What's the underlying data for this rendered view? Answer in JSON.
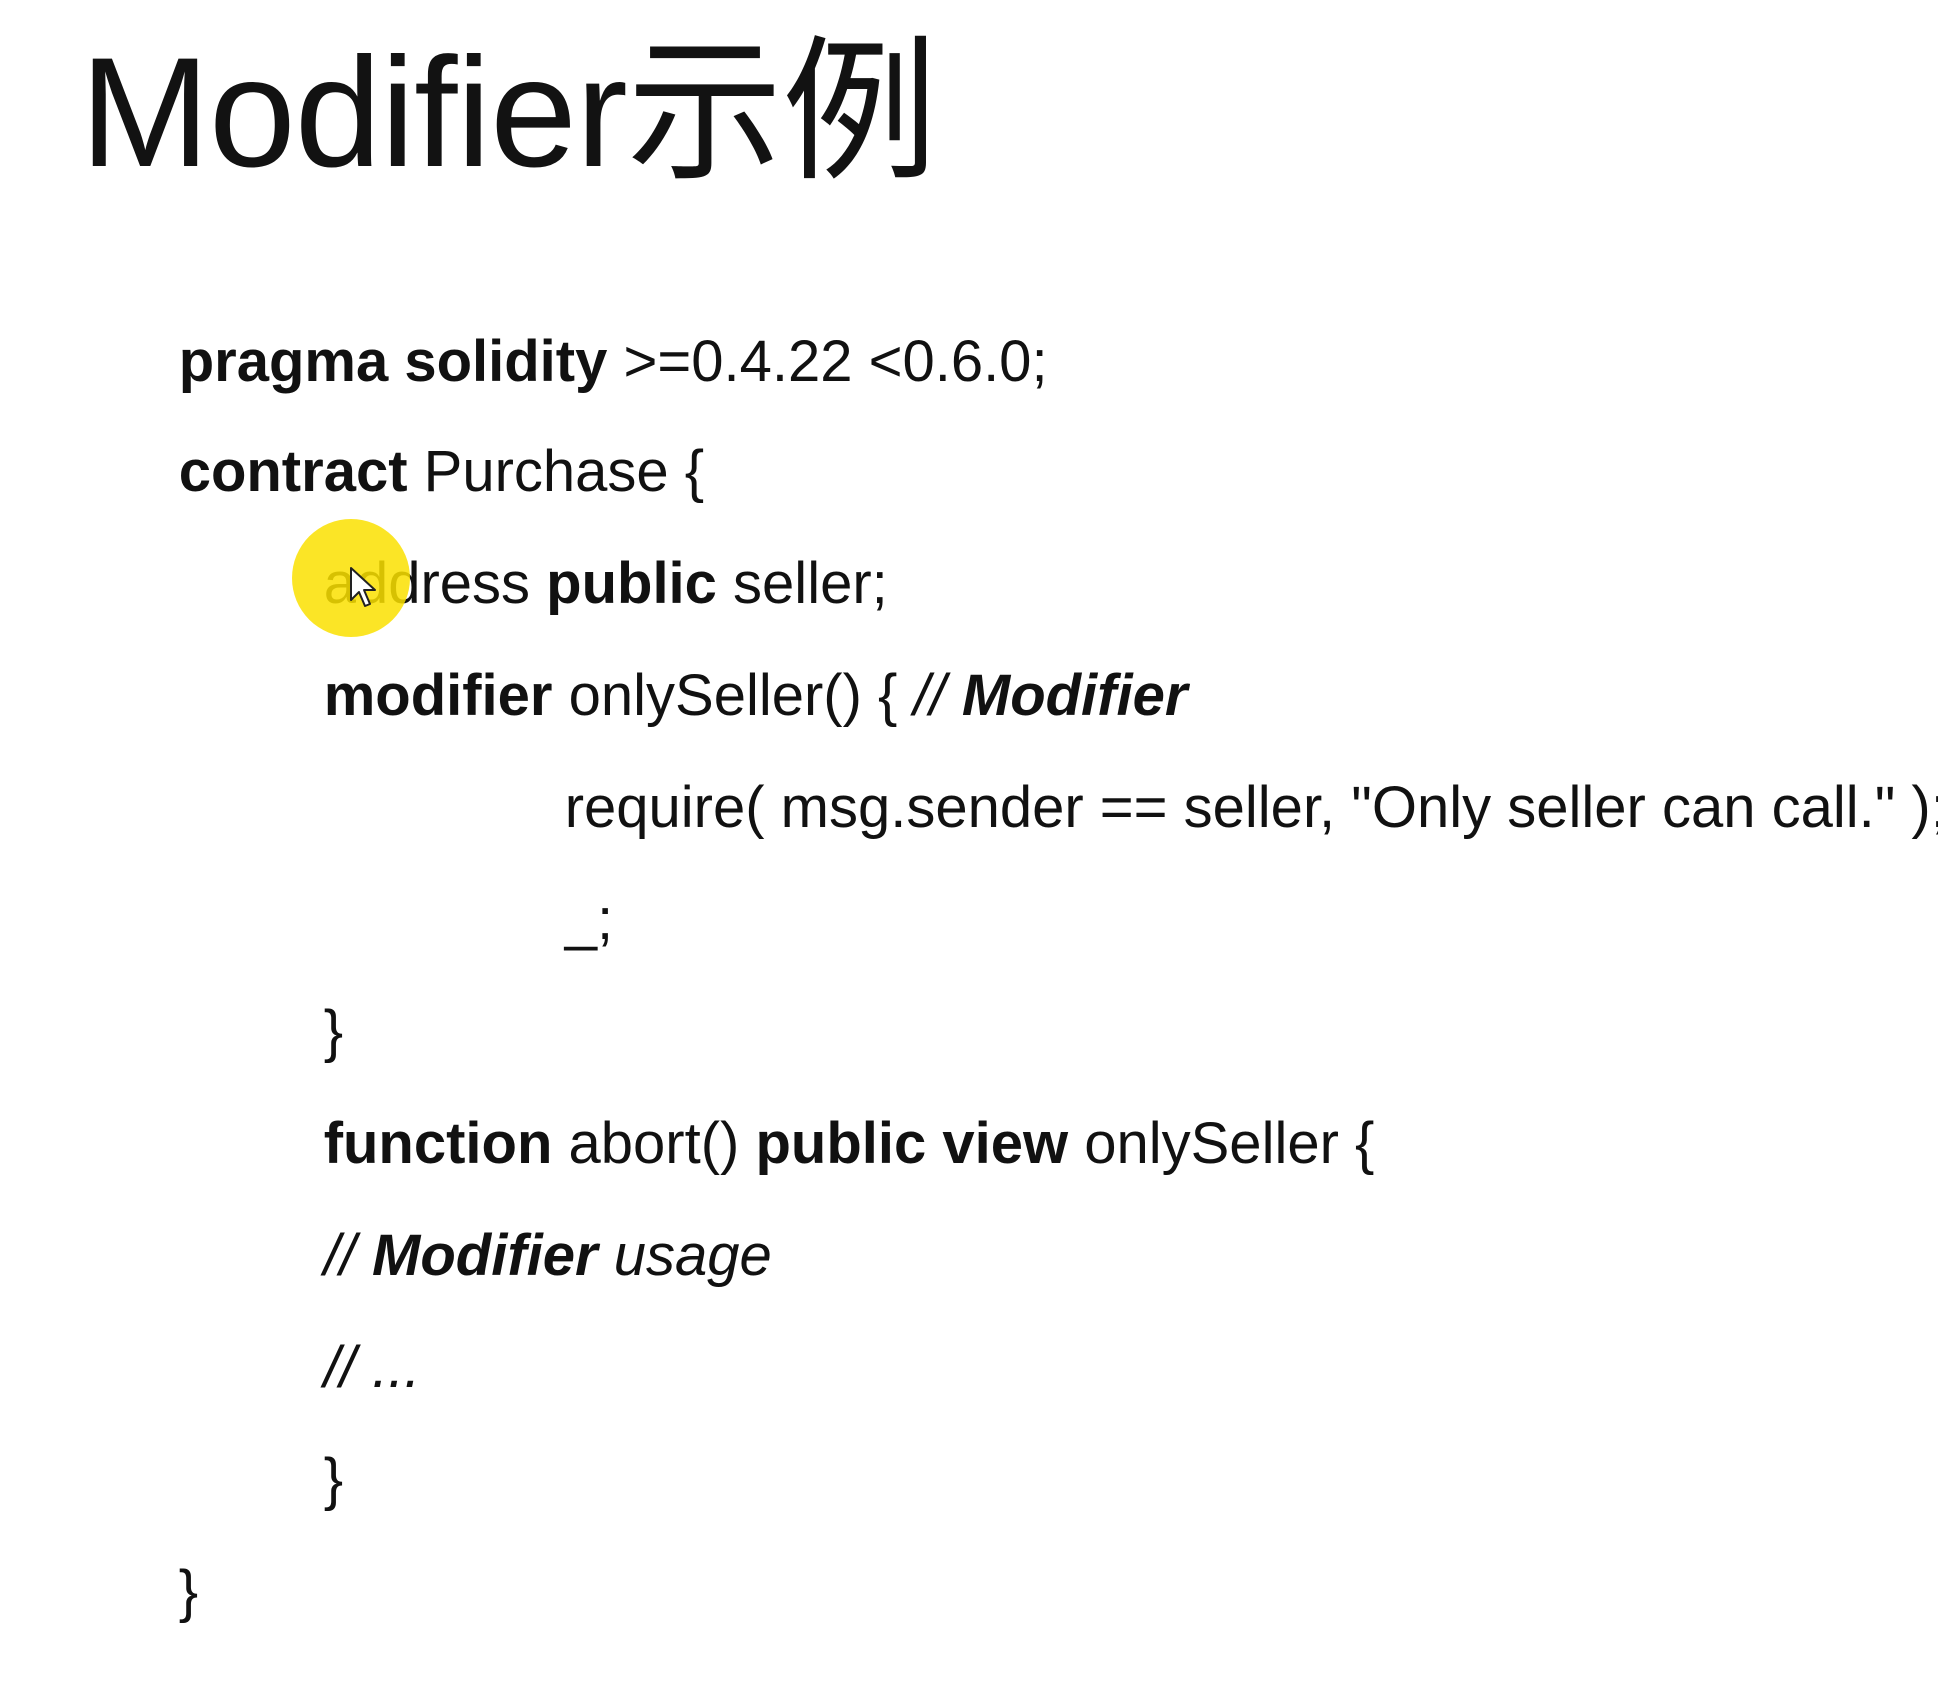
{
  "slide": {
    "title": "Modifier示例",
    "code_lines": {
      "l1": {
        "a": "pragma solidity",
        "b": " >=0.4.22 <0.6.0;"
      },
      "l2": {
        "a": "contract",
        "b": " Purchase {"
      },
      "l3": {
        "a": "address ",
        "b": "public",
        "c": " seller;"
      },
      "l4": {
        "a": "modifier",
        "b": " onlySeller() { ",
        "c": "// ",
        "d": "Modifier"
      },
      "l5": {
        "a": "require( msg.sender == seller, \"Only seller can call.\" );"
      },
      "l6": {
        "a": "_;"
      },
      "l7": {
        "a": "}"
      },
      "l8": {
        "a": "function",
        "b": " abort() ",
        "c": "public view",
        "d": " onlySeller {"
      },
      "l9": {
        "a": "// ",
        "b": "Modifier",
        "c": " usage"
      },
      "l10": {
        "a": "// ..."
      },
      "l11": {
        "a": "}"
      },
      "l12": {
        "a": "}"
      }
    },
    "cursor_highlight_color": "#fae000"
  }
}
